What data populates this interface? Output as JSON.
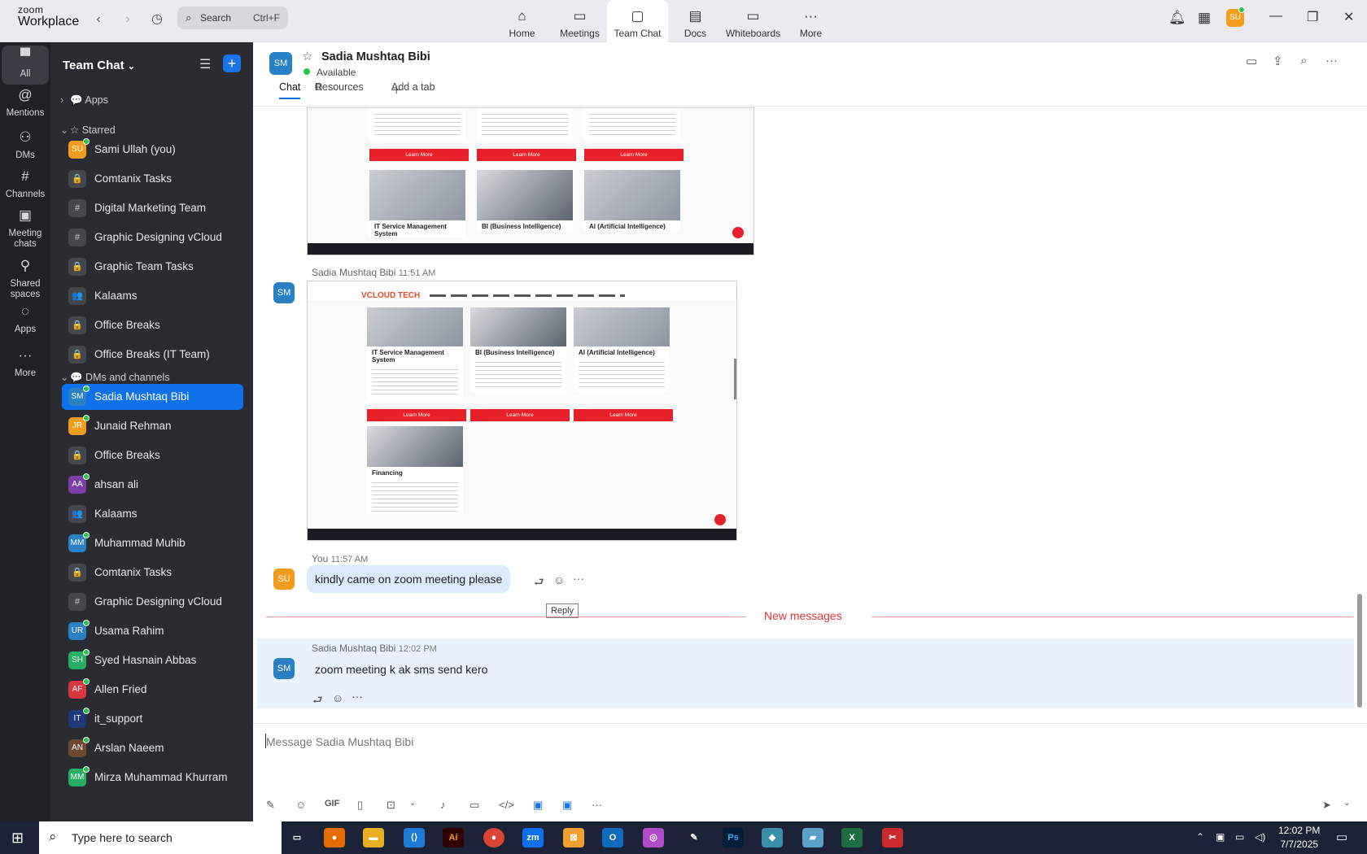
{
  "app": {
    "logo_top": "zoom",
    "logo_bottom": "Workplace"
  },
  "search": {
    "label": "Search",
    "shortcut": "Ctrl+F"
  },
  "tabs": [
    {
      "label": "Home",
      "icon": "home-icon",
      "glyph": "⌂"
    },
    {
      "label": "Meetings",
      "icon": "video-icon",
      "glyph": "▭"
    },
    {
      "label": "Team Chat",
      "icon": "chat-icon",
      "glyph": "▢"
    },
    {
      "label": "Docs",
      "icon": "doc-icon",
      "glyph": "▤"
    },
    {
      "label": "Whiteboards",
      "icon": "whiteboard-icon",
      "glyph": "▭"
    },
    {
      "label": "More",
      "icon": "more-icon",
      "glyph": "···"
    }
  ],
  "user": {
    "initials": "SU"
  },
  "rail": [
    {
      "label": "All",
      "icon": "chat-bubble-icon",
      "glyph": "▀"
    },
    {
      "label": "Mentions",
      "icon": "at-icon",
      "glyph": "@"
    },
    {
      "label": "DMs",
      "icon": "people-icon",
      "glyph": "⚇"
    },
    {
      "label": "Channels",
      "icon": "hash-icon",
      "glyph": "#"
    },
    {
      "label": "Meeting chats",
      "icon": "calendar-icon",
      "glyph": "▣"
    },
    {
      "label": "Shared spaces",
      "icon": "share-icon",
      "glyph": "⚲"
    },
    {
      "label": "Apps",
      "icon": "apps-icon",
      "glyph": "◌"
    },
    {
      "label": "More",
      "icon": "more-icon",
      "glyph": "···"
    }
  ],
  "sidebar": {
    "title": "Team Chat",
    "apps_label": "Apps",
    "starred_label": "Starred",
    "dms_label": "DMs and channels",
    "starred": [
      {
        "name": "Sami Ullah (you)",
        "initials": "SU",
        "color": "#f29c1e",
        "type": "user"
      },
      {
        "name": "Comtanix Tasks",
        "glyph": "🔒",
        "type": "channel"
      },
      {
        "name": "Digital Marketing Team",
        "glyph": "#",
        "type": "channel"
      },
      {
        "name": "Graphic Designing vCloud",
        "glyph": "#",
        "type": "channel"
      },
      {
        "name": "Graphic Team Tasks",
        "glyph": "🔒",
        "type": "channel"
      },
      {
        "name": "Kalaams",
        "glyph": "👥",
        "type": "channel"
      },
      {
        "name": "Office Breaks",
        "glyph": "🔒",
        "type": "channel"
      },
      {
        "name": "Office Breaks (IT Team)",
        "glyph": "🔒",
        "type": "channel"
      }
    ],
    "dms": [
      {
        "name": "Sadia Mushtaq Bibi",
        "initials": "SM",
        "color": "#2980c4",
        "type": "user",
        "active": true
      },
      {
        "name": "Junaid Rehman",
        "initials": "JR",
        "color": "#f29c1e",
        "type": "user"
      },
      {
        "name": "Office Breaks",
        "glyph": "🔒",
        "type": "channel"
      },
      {
        "name": "ahsan ali",
        "initials": "AA",
        "color": "#7b3fa7",
        "type": "user"
      },
      {
        "name": "Kalaams",
        "glyph": "👥",
        "type": "channel"
      },
      {
        "name": "Muhammad Muhib",
        "initials": "MM",
        "color": "#2980c4",
        "type": "user"
      },
      {
        "name": "Comtanix Tasks",
        "glyph": "🔒",
        "type": "channel"
      },
      {
        "name": "Graphic Designing vCloud",
        "glyph": "#",
        "type": "channel"
      },
      {
        "name": "Usama Rahim",
        "initials": "UR",
        "color": "#2980c4",
        "type": "user"
      },
      {
        "name": "Syed Hasnain Abbas",
        "initials": "SH",
        "color": "#27ae60",
        "type": "user"
      },
      {
        "name": "Allen Fried",
        "initials": "AF",
        "color": "#d9363e",
        "type": "user"
      },
      {
        "name": "it_support",
        "initials": "IT",
        "color": "#1e3a7b",
        "type": "user"
      },
      {
        "name": "Arslan Naeem",
        "initials": "AN",
        "color": "#6b4a2e",
        "type": "user"
      },
      {
        "name": "Mirza Muhammad Khurram",
        "initials": "MM",
        "color": "#27ae60",
        "type": "user"
      }
    ]
  },
  "chat": {
    "name": "Sadia Mushtaq Bibi",
    "initials": "SM",
    "status": "Available",
    "tabs": {
      "chat": "Chat",
      "resources": "Resources",
      "add": "Add a tab"
    },
    "messages": [
      {
        "sender": "Sadia Mushtaq Bibi",
        "time": "11:51 AM"
      },
      {
        "sender": "You",
        "time": "11:57 AM",
        "text": "kindly came on zoom meeting please"
      },
      {
        "sender": "Sadia Mushtaq Bibi",
        "time": "12:02 PM",
        "text": "zoom meeting k ak sms send kero"
      }
    ],
    "reply_tooltip": "Reply",
    "new_messages": "New messages",
    "shot1": {
      "cards": [
        {
          "title": "IT Service Management System",
          "btn": "Learn More"
        },
        {
          "title": "BI (Business Intelligence)",
          "btn": "Learn More"
        },
        {
          "title": "AI (Artificial Intelligence)",
          "btn": "Learn More"
        }
      ]
    },
    "shot2": {
      "brand": "VCLOUD TECH",
      "cards": [
        {
          "title": "IT Service Management System",
          "btn": "Learn More"
        },
        {
          "title": "BI (Business Intelligence)",
          "btn": "Learn More"
        },
        {
          "title": "AI (Artificial Intelligence)",
          "btn": "Learn More"
        },
        {
          "title": "Financing"
        }
      ]
    }
  },
  "compose": {
    "placeholder": "Message Sadia Mushtaq Bibi",
    "gif": "GIF"
  },
  "taskbar": {
    "search": "Type here to search",
    "time": "12:02 PM",
    "date": "7/7/2025"
  }
}
